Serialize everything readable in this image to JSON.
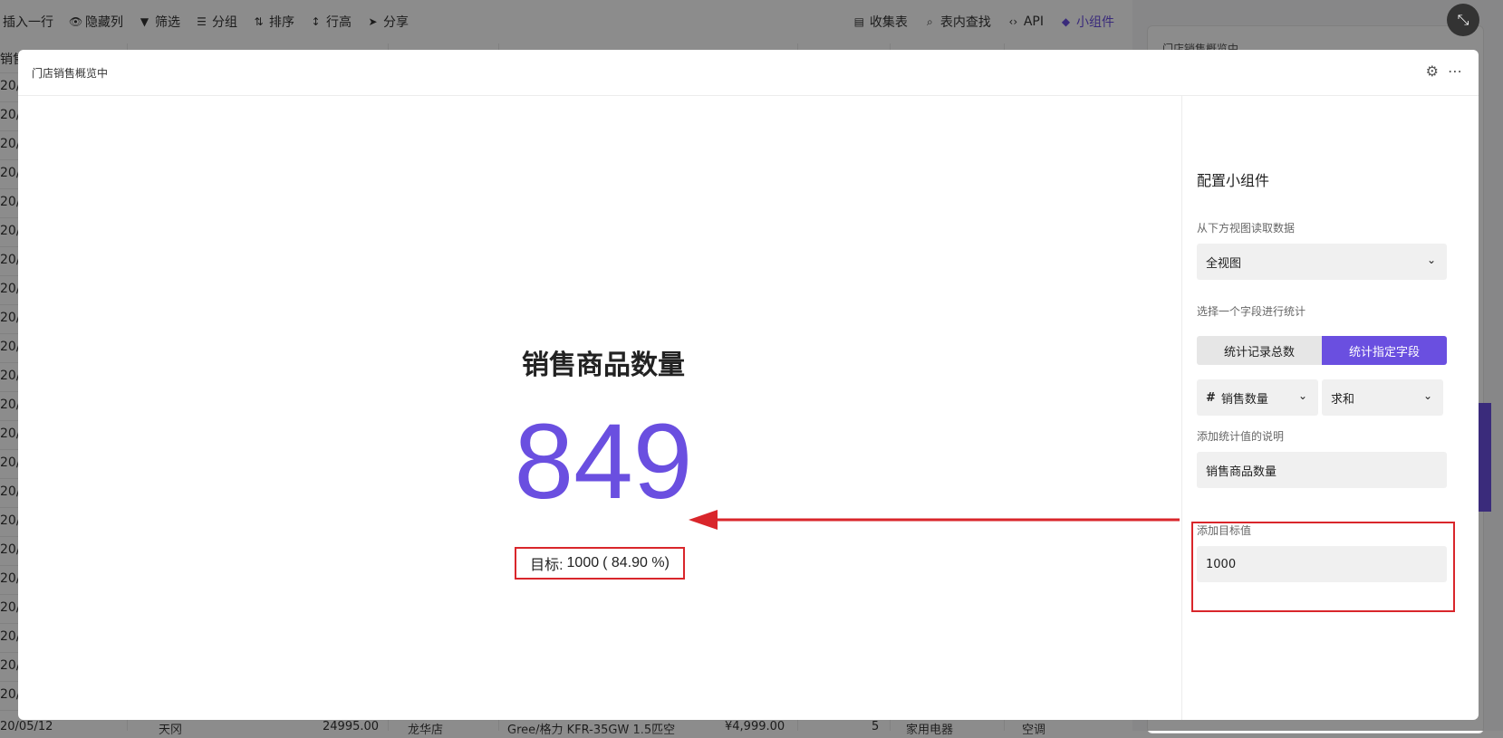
{
  "toolbar": {
    "insert_row": "插入一行",
    "hide_columns": "隐藏列",
    "filter": "筛选",
    "group": "分组",
    "sort": "排序",
    "row_height": "行高",
    "share": "分享",
    "form": "收集表",
    "find": "表内查找",
    "api": "API",
    "widgets": "小组件"
  },
  "background": {
    "header_cell": "销售",
    "row_date": "20/0",
    "right_panel_title": "门店销售概览中",
    "right_panel_snippet": "店",
    "last_row": {
      "date": "20/05/12",
      "person": "天冈",
      "amount": "24995.00",
      "store": "龙华店",
      "product": "Gree/格力 KFR-35GW 1.5匹空",
      "price": "¥4,999.00",
      "qty": "5",
      "category": "家用电器",
      "subcategory": "空调"
    }
  },
  "modal": {
    "title": "门店销售概览中"
  },
  "widget": {
    "label": "销售商品数量",
    "value": "849",
    "target_prefix": "目标:",
    "target_value": "1000",
    "target_percent": "( 84.90 %)"
  },
  "config": {
    "title": "配置小组件",
    "view_label": "从下方视图读取数据",
    "view_value": "全视图",
    "stat_label": "选择一个字段进行统计",
    "mode_count": "统计记录总数",
    "mode_field": "统计指定字段",
    "field_value": "销售数量",
    "agg_value": "求和",
    "desc_label": "添加统计值的说明",
    "desc_value": "销售商品数量",
    "target_label": "添加目标值",
    "target_value": "1000"
  },
  "colors": {
    "accent": "#6a4fe0",
    "annotation": "#d9262b"
  }
}
